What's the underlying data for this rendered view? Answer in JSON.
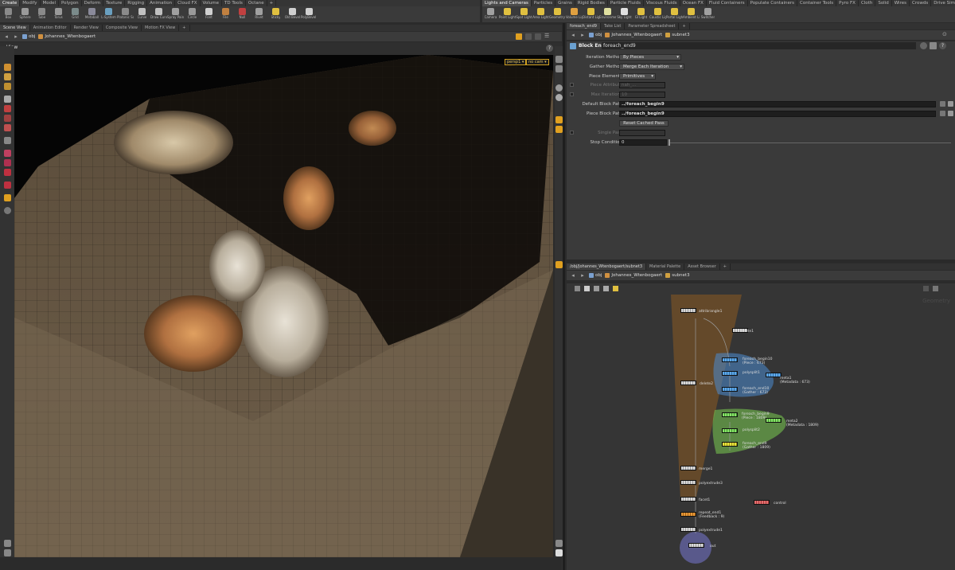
{
  "shelf": {
    "tabs_left": [
      "Create",
      "Modify",
      "Model",
      "Polygon",
      "Deform",
      "Texture",
      "Rigging",
      "Animation",
      "Cloud FX",
      "Volume",
      "TD Tools",
      "Octane",
      "+"
    ],
    "tools_left": [
      {
        "label": "Box",
        "color": "#8a8a8a"
      },
      {
        "label": "Sphere",
        "color": "#9a9a9a"
      },
      {
        "label": "Tube",
        "color": "#8a8a8a"
      },
      {
        "label": "Torus",
        "color": "#9a9a9a"
      },
      {
        "label": "Grid",
        "color": "#7a8a8a"
      },
      {
        "label": "Metaball",
        "color": "#8a8a9a"
      },
      {
        "label": "L-System",
        "color": "#6aa0c0"
      },
      {
        "label": "Platonic Sol...",
        "color": "#8a8a8a"
      },
      {
        "label": "Curve",
        "color": "#c0c0c0"
      },
      {
        "label": "Draw Curve",
        "color": "#c0c0c0"
      },
      {
        "label": "Spray Paint",
        "color": "#a0a0a0"
      },
      {
        "label": "Circle",
        "color": "#9a9a9a"
      },
      {
        "label": "Font",
        "color": "#d0d0d0"
      },
      {
        "label": "File",
        "color": "#c08040"
      },
      {
        "label": "Null",
        "color": "#c04040"
      },
      {
        "label": "Rivet",
        "color": "#a0a0a0"
      },
      {
        "label": "Sticky",
        "color": "#e0c040"
      },
      {
        "label": "Old Bevel",
        "color": "#d0d0d0"
      },
      {
        "label": "PolyBevel 1.0",
        "color": "#d0d0d0"
      }
    ],
    "tabs_right": [
      "Lights and Cameras",
      "Particles",
      "Grains",
      "Rigid Bodies",
      "Particle Fluids",
      "Viscous Fluids",
      "Ocean FX",
      "Fluid Containers",
      "Populate Containers",
      "Container Tools",
      "Pyro FX",
      "Cloth",
      "Solid",
      "Wires",
      "Crowds",
      "Drive Simulation",
      "Octane",
      "+"
    ],
    "tools_right": [
      {
        "label": "Camera",
        "color": "#a0a0a0"
      },
      {
        "label": "Point Light",
        "color": "#e0c040"
      },
      {
        "label": "Spot Light",
        "color": "#e0c040"
      },
      {
        "label": "Area Light",
        "color": "#e0c040"
      },
      {
        "label": "Geometry L...",
        "color": "#e0c040"
      },
      {
        "label": "Volume Light",
        "color": "#e0a040"
      },
      {
        "label": "Distant Light",
        "color": "#e0c040"
      },
      {
        "label": "Environmen...",
        "color": "#e0e0a0"
      },
      {
        "label": "Sky Light",
        "color": "#e0e0e0"
      },
      {
        "label": "GI Light",
        "color": "#e0c040"
      },
      {
        "label": "Caustic Light",
        "color": "#e0c040"
      },
      {
        "label": "Portal Light",
        "color": "#e0c040"
      },
      {
        "label": "Ambient Lig...",
        "color": "#e0c040"
      },
      {
        "label": "Switcher",
        "color": "#a0a0a0"
      }
    ]
  },
  "left_pane": {
    "tabs": [
      "Scene View",
      "Animation Editor",
      "Render View",
      "Composite View",
      "Motion FX View",
      "+"
    ],
    "path": [
      "obj",
      "Johannes_Wtenbogaert"
    ],
    "view_title": "View",
    "camera_btn": "persp1",
    "cam_btn": "no cam"
  },
  "param_pane": {
    "tabs": [
      "foreach_end9",
      "Take List",
      "Parameter Spreadsheet",
      "+"
    ],
    "path": [
      "obj",
      "Johannes_Wtenbogaert",
      "subnet3"
    ],
    "node_type": "Block End",
    "node_name": "foreach_end9",
    "params": [
      {
        "label": "Iteration Method",
        "value": "By Pieces",
        "kind": "menu",
        "enabled": true
      },
      {
        "label": "Gather Method",
        "value": "Merge Each Iteration",
        "kind": "menu",
        "enabled": true
      },
      {
        "label": "Piece Elements",
        "value": "Primitives",
        "kind": "menu",
        "enabled": true
      },
      {
        "label": "Piece Attribute",
        "value": "nah_...",
        "kind": "field",
        "enabled": false,
        "check": true
      },
      {
        "label": "Max Iterations",
        "value": "10",
        "kind": "field",
        "enabled": false,
        "check": true
      },
      {
        "label": "Default Block Path",
        "value": "../foreach_begin9",
        "kind": "path",
        "enabled": true
      },
      {
        "label": "Piece Block Path",
        "value": "../foreach_begin9",
        "kind": "path",
        "enabled": true
      },
      {
        "label": "",
        "value": "Reset Cached Pass",
        "kind": "button",
        "enabled": true
      },
      {
        "label": "Single Pass",
        "value": "",
        "kind": "field",
        "enabled": false,
        "check": true
      },
      {
        "label": "Stop Condition",
        "value": "0",
        "kind": "slider",
        "enabled": true
      }
    ]
  },
  "network_pane": {
    "tabs": [
      "/obj/Johannes_Wtenbogaert/subnet3",
      "Material Palette",
      "Asset Browser",
      "+"
    ],
    "path": [
      "obj",
      "Johannes_Wtenbogaert",
      "subnet3"
    ],
    "watermark": "Geometry",
    "nodes": [
      {
        "name": "attribrangle1",
        "color": "grey"
      },
      {
        "name": "delete1",
        "color": "grey"
      },
      {
        "name": "foreach_begin10\n(Piece : 673)",
        "color": "blue"
      },
      {
        "name": "polysplit1",
        "color": "blue"
      },
      {
        "name": "foreach_end10\n(Gather : 673)",
        "color": "blue"
      },
      {
        "name": "meta1\n(Metadata : 673)",
        "color": "blue"
      },
      {
        "name": "delete2",
        "color": "grey"
      },
      {
        "name": "foreach_begin9\n(Piece : 1809)",
        "color": "green"
      },
      {
        "name": "polysplit2",
        "color": "green"
      },
      {
        "name": "meta2\n(Metadata : 1809)",
        "color": "green"
      },
      {
        "name": "foreach_end9\n(Gather : 1809)",
        "color": "yellow"
      },
      {
        "name": "merge1",
        "color": "grey"
      },
      {
        "name": "polyextrude3",
        "color": "grey"
      },
      {
        "name": "facet1",
        "color": "grey"
      },
      {
        "name": "repeat_end1\n(Feedback : 9)",
        "color": "orange"
      },
      {
        "name": "polyextrude1",
        "color": "grey"
      },
      {
        "name": "out",
        "color": "grey"
      },
      {
        "name": "control",
        "color": "red"
      }
    ]
  }
}
